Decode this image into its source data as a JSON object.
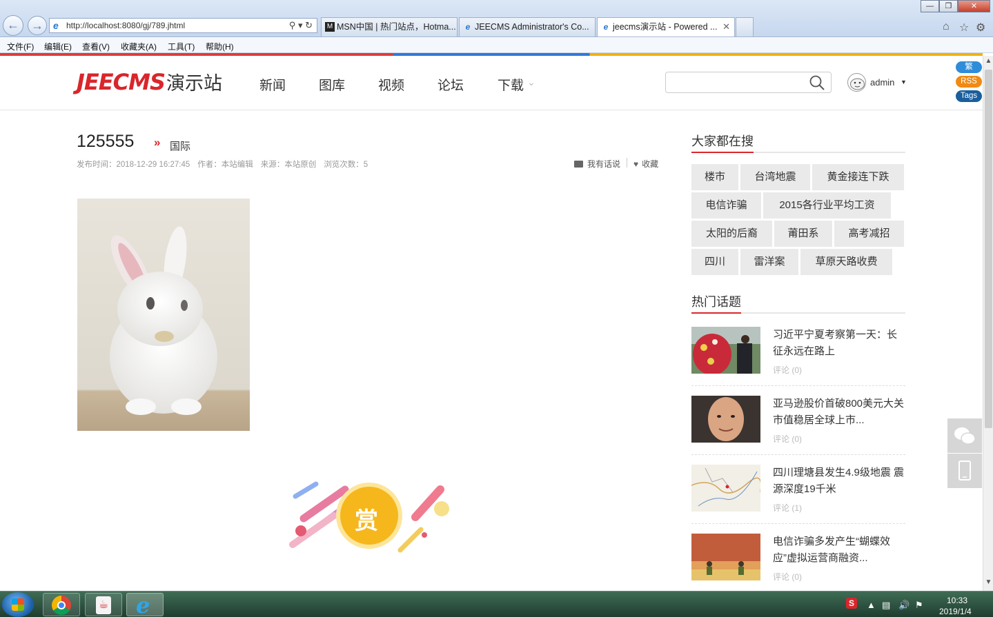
{
  "browser": {
    "url": "http://localhost:8080/gj/789.jhtml",
    "tabs": [
      {
        "label": "MSN中国 | 热门站点，Hotma..."
      },
      {
        "label": "JEECMS Administrator's Co..."
      },
      {
        "label": "jeecms演示站 - Powered ..."
      }
    ],
    "menu": [
      "文件(F)",
      "编辑(E)",
      "查看(V)",
      "收藏夹(A)",
      "工具(T)",
      "帮助(H)"
    ]
  },
  "site": {
    "logo_en": "JEECMS",
    "logo_cn": "演示站",
    "nav": [
      "新闻",
      "图库",
      "视频",
      "论坛",
      "下载"
    ],
    "search_placeholder": "",
    "username": "admin",
    "badges": [
      "繁",
      "RSS",
      "Tags"
    ]
  },
  "article": {
    "title": "125555",
    "category": "国际",
    "meta": {
      "publish_time": "发布时间：2018-12-29 16:27:45",
      "author": "作者：本站编辑",
      "source": "来源：本站原创",
      "views": "浏览次数：5"
    },
    "comment_label": "我有话说",
    "favorite_label": "收藏",
    "reward_label": "赏"
  },
  "sidebar": {
    "search_heading": "大家都在搜",
    "tags": [
      [
        "楼市",
        "台湾地震",
        "黄金接连下跌"
      ],
      [
        "电信诈骗",
        "2015各行业平均工资"
      ],
      [
        "太阳的后裔",
        "莆田系",
        "高考减招"
      ],
      [
        "四川",
        "雷洋案",
        "草原天路收费"
      ]
    ],
    "topics_heading": "热门话题",
    "topics": [
      {
        "title": "习近平宁夏考察第一天：长征永远在路上",
        "comments": "评论 (0)"
      },
      {
        "title": "亚马逊股价首破800美元大关 市值稳居全球上市...",
        "comments": "评论 (0)"
      },
      {
        "title": "四川理塘县发生4.9级地震 震源深度19千米",
        "comments": "评论 (1)"
      },
      {
        "title": "电信诈骗多发产生“蝴蝶效应”虚拟运营商融资...",
        "comments": "评论 (0)"
      }
    ]
  },
  "taskbar": {
    "time": "10:33",
    "date": "2019/1/4"
  },
  "colors": {
    "brand_red": "#d9262b",
    "badge_blue": "#2f8cd8",
    "badge_orange": "#f08a14",
    "badge_darkblue": "#1a5e9c"
  }
}
